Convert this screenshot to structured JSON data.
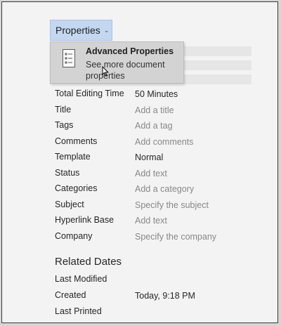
{
  "properties_button": {
    "label": "Properties"
  },
  "popup": {
    "title": "Advanced Properties",
    "description": "See more document properties"
  },
  "rows": [
    {
      "label": "Total Editing Time",
      "value": "50 Minutes",
      "filled": true
    },
    {
      "label": "Title",
      "value": "Add a title",
      "filled": false
    },
    {
      "label": "Tags",
      "value": "Add a tag",
      "filled": false
    },
    {
      "label": "Comments",
      "value": "Add comments",
      "filled": false
    },
    {
      "label": "Template",
      "value": "Normal",
      "filled": true
    },
    {
      "label": "Status",
      "value": "Add text",
      "filled": false
    },
    {
      "label": "Categories",
      "value": "Add a category",
      "filled": false
    },
    {
      "label": "Subject",
      "value": "Specify the subject",
      "filled": false
    },
    {
      "label": "Hyperlink Base",
      "value": "Add text",
      "filled": false
    },
    {
      "label": "Company",
      "value": "Specify the company",
      "filled": false
    }
  ],
  "related_dates": {
    "title": "Related Dates",
    "rows": [
      {
        "label": "Last Modified",
        "value": ""
      },
      {
        "label": "Created",
        "value": "Today, 9:18 PM"
      },
      {
        "label": "Last Printed",
        "value": ""
      }
    ]
  }
}
